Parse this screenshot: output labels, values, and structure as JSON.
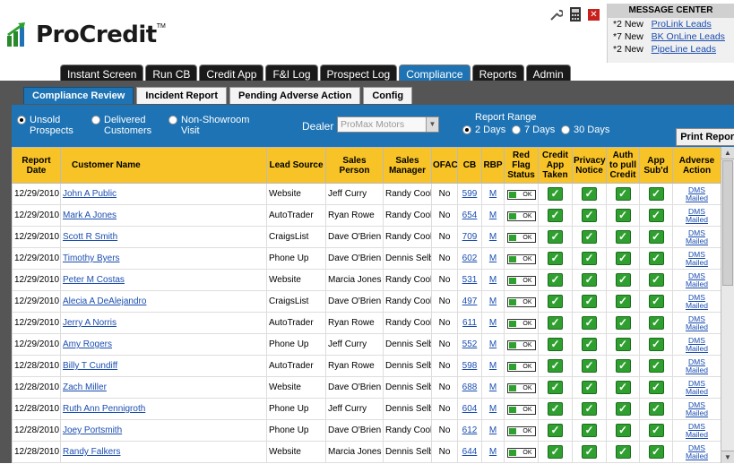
{
  "brand": {
    "name": "ProCredit",
    "tm": "TM"
  },
  "message_center": {
    "title": "MESSAGE CENTER",
    "rows": [
      {
        "count": "*2 New",
        "link": "ProLink Leads"
      },
      {
        "count": "*7 New",
        "link": "BK OnLine Leads"
      },
      {
        "count": "*2 New",
        "link": "PipeLine Leads"
      }
    ]
  },
  "nav": {
    "tabs": [
      "Instant Screen",
      "Run CB",
      "Credit App",
      "F&I Log",
      "Prospect Log",
      "Compliance",
      "Reports",
      "Admin"
    ],
    "active": "Compliance"
  },
  "subtabs": {
    "tabs": [
      "Compliance Review",
      "Incident Report",
      "Pending Adverse Action",
      "Config"
    ],
    "active": "Compliance Review"
  },
  "filters": {
    "status": [
      {
        "label1": "Unsold",
        "label2": "Prospects",
        "selected": true
      },
      {
        "label1": "Delivered",
        "label2": "Customers",
        "selected": false
      },
      {
        "label1": "Non-Showroom",
        "label2": "Visit",
        "selected": false
      }
    ],
    "dealer_label": "Dealer",
    "dealer_value": "ProMax Motors",
    "range_label": "Report Range",
    "range_options": [
      {
        "label": "2 Days",
        "selected": true
      },
      {
        "label": "7 Days",
        "selected": false
      },
      {
        "label": "30 Days",
        "selected": false
      }
    ],
    "print_label": "Print Report"
  },
  "table": {
    "headers": [
      "Report Date",
      "Customer Name",
      "Lead Source",
      "Sales Person",
      "Sales Manager",
      "OFAC",
      "CB",
      "RBP",
      "Red Flag Status",
      "Credit App Taken",
      "Privacy Notice",
      "Auth to pull Credit",
      "App Sub'd",
      "Adverse Action"
    ],
    "ok_label": "OK",
    "adverse_label_1": "DMS",
    "adverse_label_2": "Mailed",
    "rows": [
      {
        "date": "12/29/2010",
        "name": "John A Public",
        "source": "Website",
        "sales": "Jeff Curry",
        "manager": "Randy Cook",
        "ofac": "No",
        "cb": "599",
        "rbp": "M"
      },
      {
        "date": "12/29/2010",
        "name": "Mark A Jones",
        "source": "AutoTrader",
        "sales": "Ryan Rowe",
        "manager": "Randy Cook",
        "ofac": "No",
        "cb": "654",
        "rbp": "M"
      },
      {
        "date": "12/29/2010",
        "name": "Scott R Smith",
        "source": "CraigsList",
        "sales": "Dave O'Brien",
        "manager": "Randy Cook",
        "ofac": "No",
        "cb": "709",
        "rbp": "M"
      },
      {
        "date": "12/29/2010",
        "name": "Timothy Byers",
        "source": "Phone Up",
        "sales": "Dave O'Brien",
        "manager": "Dennis Selby",
        "ofac": "No",
        "cb": "602",
        "rbp": "M"
      },
      {
        "date": "12/29/2010",
        "name": "Peter M Costas",
        "source": "Website",
        "sales": "Marcia Jones",
        "manager": "Randy Cook",
        "ofac": "No",
        "cb": "531",
        "rbp": "M"
      },
      {
        "date": "12/29/2010",
        "name": "Alecia A DeAlejandro",
        "source": "CraigsList",
        "sales": "Dave O'Brien",
        "manager": "Randy Cook",
        "ofac": "No",
        "cb": "497",
        "rbp": "M"
      },
      {
        "date": "12/29/2010",
        "name": "Jerry A Norris",
        "source": "AutoTrader",
        "sales": "Ryan Rowe",
        "manager": "Randy Cook",
        "ofac": "No",
        "cb": "611",
        "rbp": "M"
      },
      {
        "date": "12/29/2010",
        "name": "Amy Rogers",
        "source": "Phone Up",
        "sales": "Jeff Curry",
        "manager": "Dennis Selby",
        "ofac": "No",
        "cb": "552",
        "rbp": "M"
      },
      {
        "date": "12/28/2010",
        "name": "Billy T Cundiff",
        "source": "AutoTrader",
        "sales": "Ryan Rowe",
        "manager": "Dennis Selby",
        "ofac": "No",
        "cb": "598",
        "rbp": "M"
      },
      {
        "date": "12/28/2010",
        "name": "Zach Miller",
        "source": "Website",
        "sales": "Dave O'Brien",
        "manager": "Dennis Selby",
        "ofac": "No",
        "cb": "688",
        "rbp": "M"
      },
      {
        "date": "12/28/2010",
        "name": "Ruth Ann Pennigroth",
        "source": "Phone Up",
        "sales": "Jeff Curry",
        "manager": "Dennis Selby",
        "ofac": "No",
        "cb": "604",
        "rbp": "M"
      },
      {
        "date": "12/28/2010",
        "name": "Joey Portsmith",
        "source": "Phone Up",
        "sales": "Dave O'Brien",
        "manager": "Randy Cook",
        "ofac": "No",
        "cb": "612",
        "rbp": "M"
      },
      {
        "date": "12/28/2010",
        "name": "Randy Falkers",
        "source": "Website",
        "sales": "Marcia Jones",
        "manager": "Dennis Selby",
        "ofac": "No",
        "cb": "644",
        "rbp": "M"
      }
    ]
  },
  "icons": {
    "tool1": "wrench-icon",
    "tool2": "calculator-icon",
    "close": "close-icon"
  },
  "colors": {
    "accent": "#1d73b4",
    "header_row": "#f7c326",
    "check": "#2fa02f",
    "close": "#c8201c"
  }
}
